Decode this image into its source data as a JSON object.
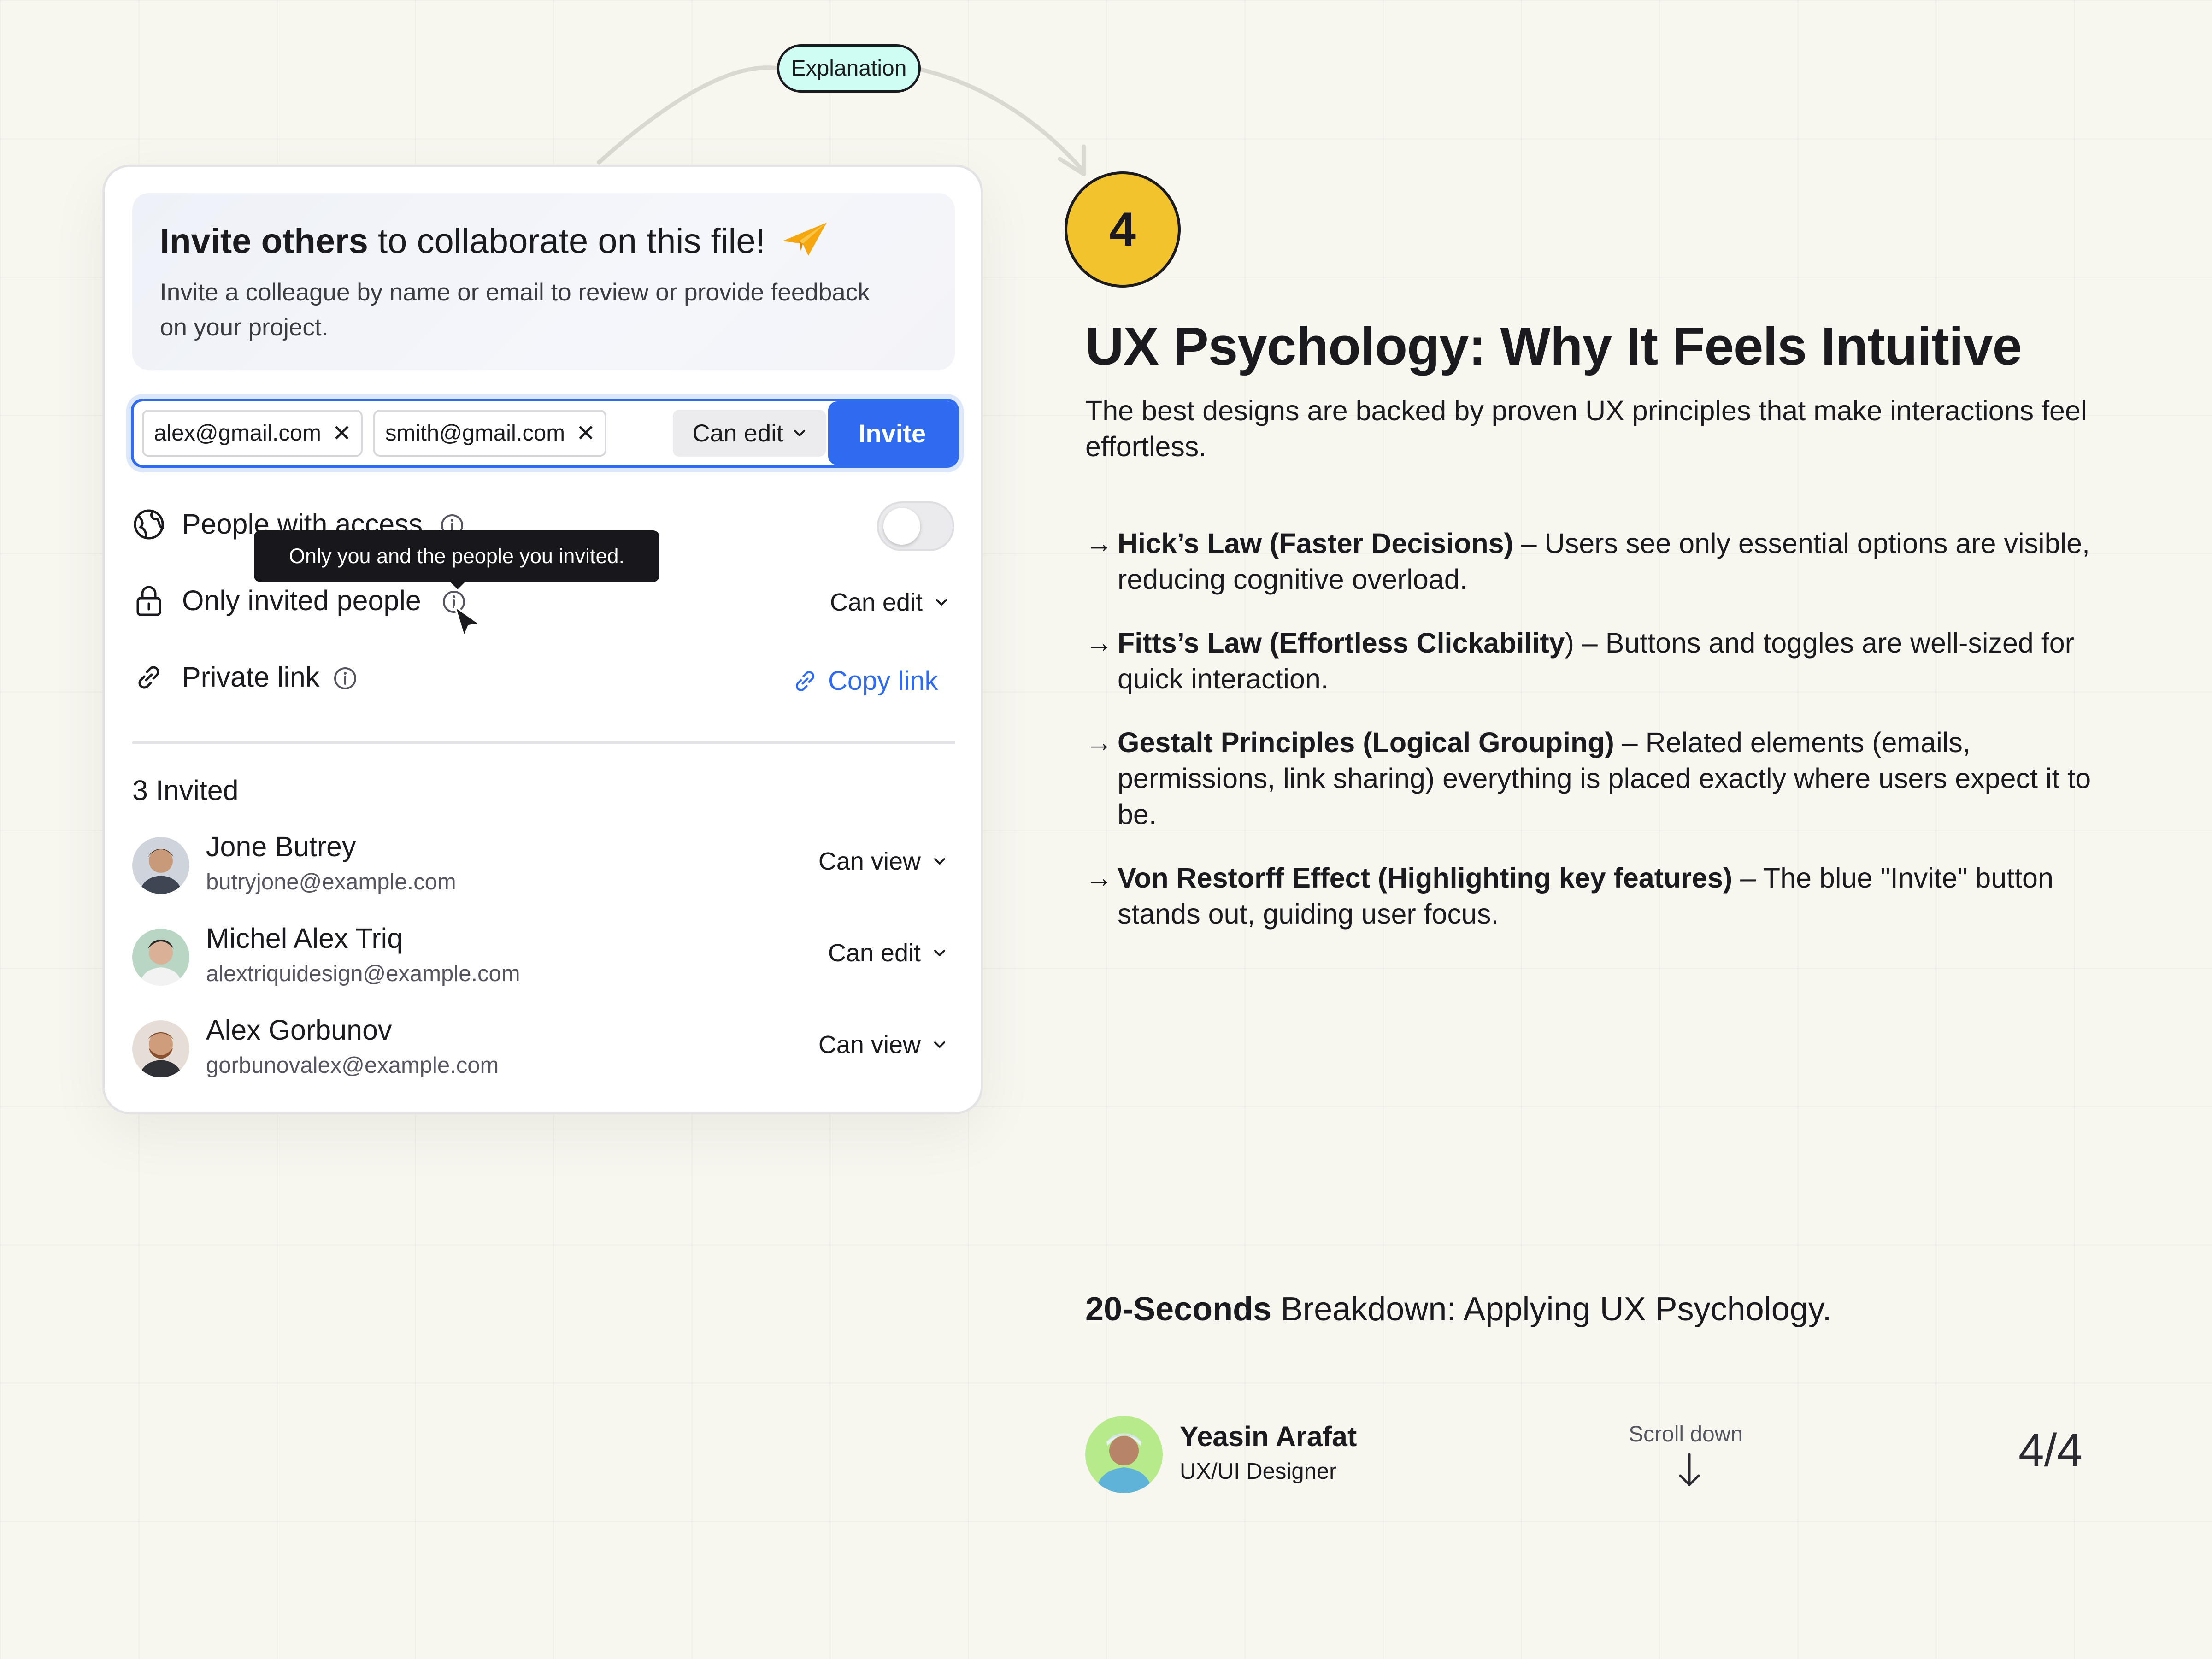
{
  "explanation_badge": "Explanation",
  "card": {
    "hero": {
      "title_bold": "Invite others",
      "title_rest": " to collaborate on this file!",
      "description": "Invite a colleague by name or email to review or provide feedback on your project."
    },
    "invite": {
      "chips": [
        "alex@gmail.com",
        "smith@gmail.com"
      ],
      "permission": "Can edit",
      "button": "Invite"
    },
    "access": {
      "people_with_access": "People with access",
      "toggle_on": false,
      "tooltip": "Only you and the people you invited.",
      "only_invited": "Only invited people",
      "only_invited_perm": "Can edit",
      "private_link": "Private link",
      "copy_link": "Copy link"
    },
    "invited": {
      "count_label": "3 Invited",
      "people": [
        {
          "name": "Jone Butrey",
          "email": "butryjone@example.com",
          "permission": "Can view"
        },
        {
          "name": "Michel Alex Triq",
          "email": "alextriquidesign@example.com",
          "permission": "Can edit"
        },
        {
          "name": "Alex Gorbunov",
          "email": "gorbunovalex@example.com",
          "permission": "Can view"
        }
      ]
    }
  },
  "right": {
    "step_number": "4",
    "title": "UX Psychology: Why It Feels Intuitive",
    "description": "The best designs are backed by proven UX principles that make interactions feel effortless.",
    "principles": [
      {
        "bold": "Hick’s Law (Faster Decisions)",
        "text": " – Users see only essential options are visible, reducing cognitive overload."
      },
      {
        "bold": "Fitts’s Law (Effortless Clickability",
        "text": ") – Buttons and toggles are well-sized for quick interaction."
      },
      {
        "bold": "Gestalt Principles (Logical Grouping)",
        "text": " – Related elements (emails, permissions, link sharing) everything is placed exactly where users expect it to be."
      },
      {
        "bold": "Von Restorff Effect (Highlighting key features)",
        "text": " – The blue \"Invite\" button stands out, guiding user focus."
      }
    ],
    "breakdown_bold": "20-Seconds",
    "breakdown_rest": " Breakdown: Applying UX Psychology."
  },
  "footer": {
    "author_name": "Yeasin Arafat",
    "author_role": "UX/UI Designer",
    "scroll_label": "Scroll down",
    "page": "4/4"
  },
  "colors": {
    "accent_blue": "#2e6bf0",
    "badge_yellow": "#f2c32c",
    "badge_cyan": "#cdfdf3",
    "background": "#f7f6ef"
  }
}
